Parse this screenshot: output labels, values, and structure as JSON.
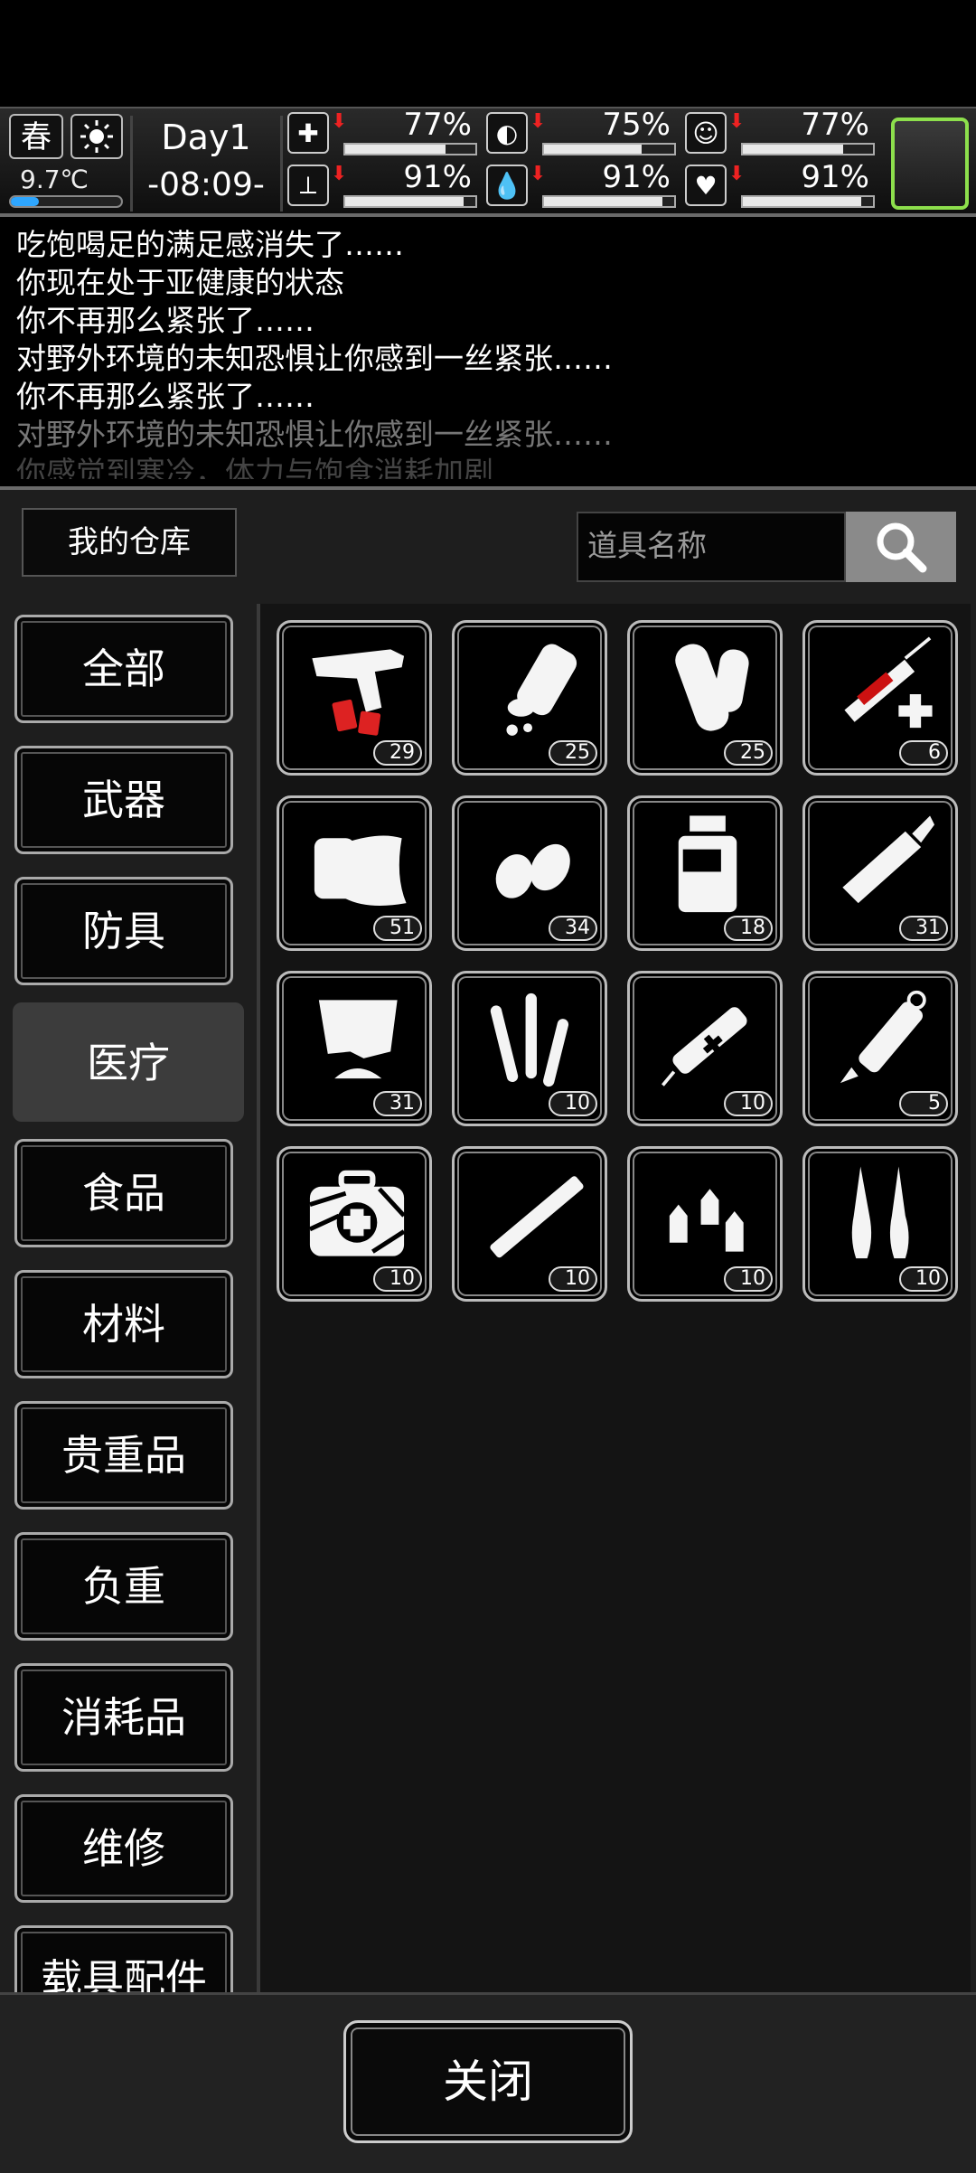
{
  "status": {
    "season": "春",
    "temperature": "9.7℃",
    "temperature_level": 0.25,
    "day": "Day1",
    "time": "-08:09-",
    "stats": [
      {
        "icon": "health-icon",
        "percent": "77%",
        "level": 0.77
      },
      {
        "icon": "stomach-icon",
        "percent": "75%",
        "level": 0.75
      },
      {
        "icon": "mood-icon",
        "percent": "77%",
        "level": 0.77
      },
      {
        "icon": "stamina-icon",
        "percent": "91%",
        "level": 0.91
      },
      {
        "icon": "water-icon",
        "percent": "91%",
        "level": 0.91
      },
      {
        "icon": "heart-icon",
        "percent": "91%",
        "level": 0.91
      }
    ]
  },
  "log": [
    "吃饱喝足的满足感消失了……",
    "你现在处于亚健康的状态",
    "你不再那么紧张了……",
    "对野外环境的未知恐惧让你感到一丝紧张……",
    "你不再那么紧张了……",
    "对野外环境的未知恐惧让你感到一丝紧张……",
    "你感觉到寒冷，体力与饱食消耗加剧"
  ],
  "warehouse": {
    "title": "我的仓库",
    "search_placeholder": "道具名称"
  },
  "categories": [
    "全部",
    "武器",
    "防具",
    "医疗",
    "食品",
    "材料",
    "贵重品",
    "负重",
    "消耗品",
    "维修",
    "载具配件"
  ],
  "active_category": "医疗",
  "items": [
    {
      "icon": "flare-gun-icon",
      "count": "29"
    },
    {
      "icon": "pill-bottle-icon",
      "count": "25"
    },
    {
      "icon": "bandage-roll-icon",
      "count": "25"
    },
    {
      "icon": "syringe-icon",
      "count": "6"
    },
    {
      "icon": "gauze-icon",
      "count": "51"
    },
    {
      "icon": "pills-icon",
      "count": "34"
    },
    {
      "icon": "medicine-jar-icon",
      "count": "18"
    },
    {
      "icon": "ointment-tube-icon",
      "count": "31"
    },
    {
      "icon": "powder-pack-icon",
      "count": "31"
    },
    {
      "icon": "test-tubes-icon",
      "count": "10"
    },
    {
      "icon": "injector-icon",
      "count": "10"
    },
    {
      "icon": "autoinjector-icon",
      "count": "5"
    },
    {
      "icon": "first-aid-kit-icon",
      "count": "10"
    },
    {
      "icon": "cigarette-icon",
      "count": "10"
    },
    {
      "icon": "eye-drops-icon",
      "count": "10"
    },
    {
      "icon": "ampoules-icon",
      "count": "10"
    }
  ],
  "close_label": "关闭"
}
